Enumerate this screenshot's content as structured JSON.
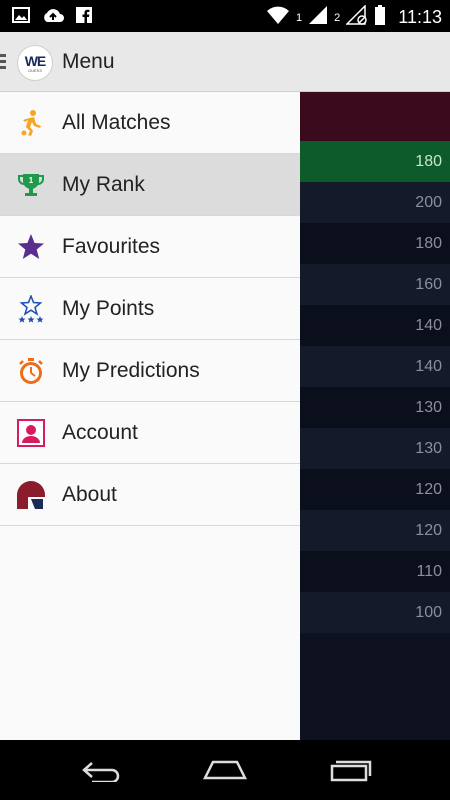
{
  "status_bar": {
    "time": "11:13",
    "sim1": "1",
    "sim2": "2",
    "icons": [
      "image-icon",
      "cloud-upload-icon",
      "facebook-icon",
      "wifi-icon",
      "signal-icon",
      "signal-off-icon",
      "battery-icon"
    ]
  },
  "app_bar": {
    "title": "Menu",
    "logo_text": "WE",
    "logo_subtext": "GUESS"
  },
  "drawer": {
    "items": [
      {
        "label": "All Matches",
        "icon": "running-person-icon",
        "active": false
      },
      {
        "label": "My Rank",
        "icon": "trophy-icon",
        "active": true
      },
      {
        "label": "Favourites",
        "icon": "star-icon",
        "active": false
      },
      {
        "label": "My Points",
        "icon": "stars-outline-icon",
        "active": false
      },
      {
        "label": "My Predictions",
        "icon": "stopwatch-icon",
        "active": false
      },
      {
        "label": "Account",
        "icon": "account-icon",
        "active": false
      },
      {
        "label": "About",
        "icon": "about-logo-icon",
        "active": false
      }
    ]
  },
  "background_list": {
    "values": [
      "180",
      "200",
      "180",
      "160",
      "140",
      "140",
      "130",
      "130",
      "120",
      "120",
      "110",
      "100"
    ]
  },
  "colors": {
    "app_bar": "#e8e8e8",
    "drawer": "#fafafa",
    "active_item": "#dcdcdc",
    "highlight_row": "#0d5b2a",
    "top_row": "#3a0b1d"
  },
  "nav_bar": {
    "buttons": [
      "back-icon",
      "home-icon",
      "recents-icon"
    ]
  }
}
